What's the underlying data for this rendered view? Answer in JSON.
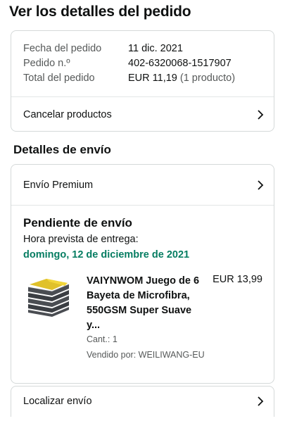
{
  "page": {
    "title": "Ver los detalles del pedido"
  },
  "summary": {
    "rows": [
      {
        "label": "Fecha del pedido",
        "value": "11 dic. 2021",
        "extra": ""
      },
      {
        "label": "Pedido n.º",
        "value": "402-6320068-1517907",
        "extra": ""
      },
      {
        "label": "Total del pedido",
        "value": "EUR 11,19",
        "extra": " (1 producto)"
      }
    ],
    "cancel_label": "Cancelar productos"
  },
  "shipping": {
    "heading": "Detalles de envío",
    "method_label": "Envío Premium",
    "status": "Pendiente de envío",
    "delivery_label": "Hora prevista de entrega:",
    "delivery_date": "domingo, 12 de diciembre de 2021",
    "accent_color": "#067d62",
    "item": {
      "title": "VAIYNWOM Juego de 6 Bayeta de Microfibra, 550GSM Super Suave y...",
      "price": "EUR 13,99",
      "qty": "Cant.: 1",
      "seller": "Vendido por: WEILIWANG-EU",
      "image_icon": "microfiber-towels-image"
    }
  },
  "tracking": {
    "label": "Localizar envío"
  }
}
